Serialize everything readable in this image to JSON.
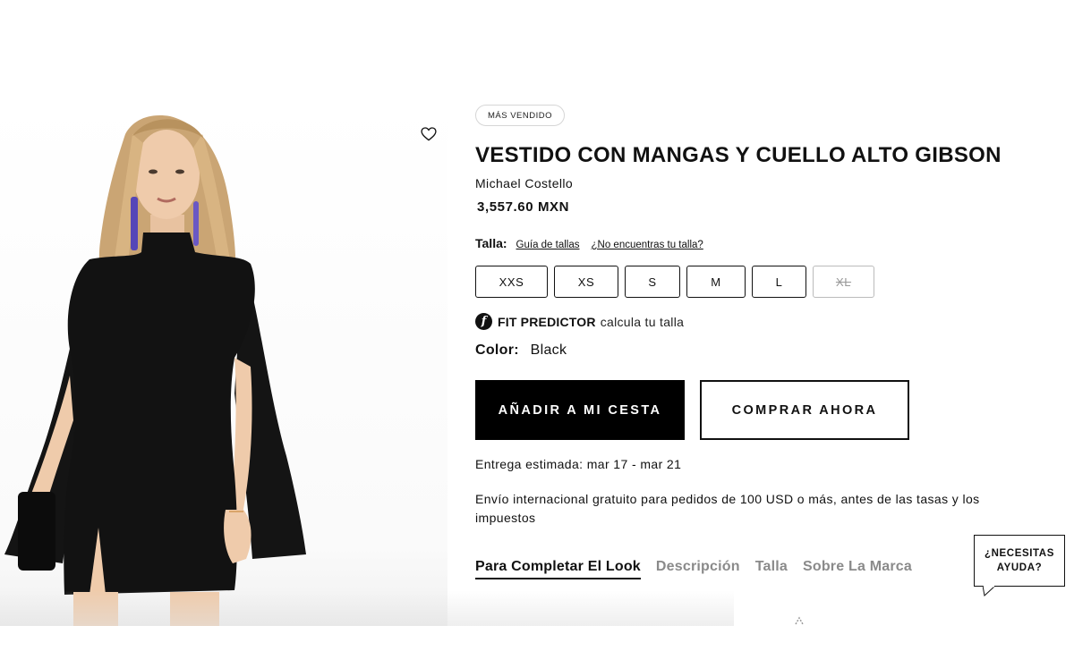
{
  "product": {
    "badge": "MÁS VENDIDO",
    "title": "VESTIDO CON MANGAS Y CUELLO ALTO GIBSON",
    "brand": "Michael Costello",
    "price": "3,557.60 MXN"
  },
  "size": {
    "label": "Talla:",
    "guide_link": "Guía de tallas",
    "missing_link": "¿No encuentras tu talla?",
    "options": [
      {
        "label": "XXS",
        "available": true
      },
      {
        "label": "XS",
        "available": true
      },
      {
        "label": "S",
        "available": true
      },
      {
        "label": "M",
        "available": true
      },
      {
        "label": "L",
        "available": true
      },
      {
        "label": "XL",
        "available": false
      }
    ]
  },
  "fit_predictor": {
    "icon": "f-logo-icon",
    "title": "FIT PREDICTOR",
    "subtitle": "calcula tu talla"
  },
  "color": {
    "label": "Color:",
    "value": "Black"
  },
  "buttons": {
    "add_to_cart": "AÑADIR A MI CESTA",
    "buy_now": "COMPRAR AHORA"
  },
  "delivery": "Entrega estimada: mar 17 - mar 21",
  "shipping": "Envío internacional gratuito para pedidos de 100 USD o más, antes de las tasas y los impuestos",
  "tabs": [
    {
      "label": "Para Completar El Look",
      "active": true
    },
    {
      "label": "Descripción",
      "active": false
    },
    {
      "label": "Talla",
      "active": false
    },
    {
      "label": "Sobre La Marca",
      "active": false
    }
  ],
  "help": {
    "line1": "¿NECESITAS",
    "line2": "AYUDA?"
  },
  "icons": {
    "wishlist": "heart-outline-icon"
  }
}
